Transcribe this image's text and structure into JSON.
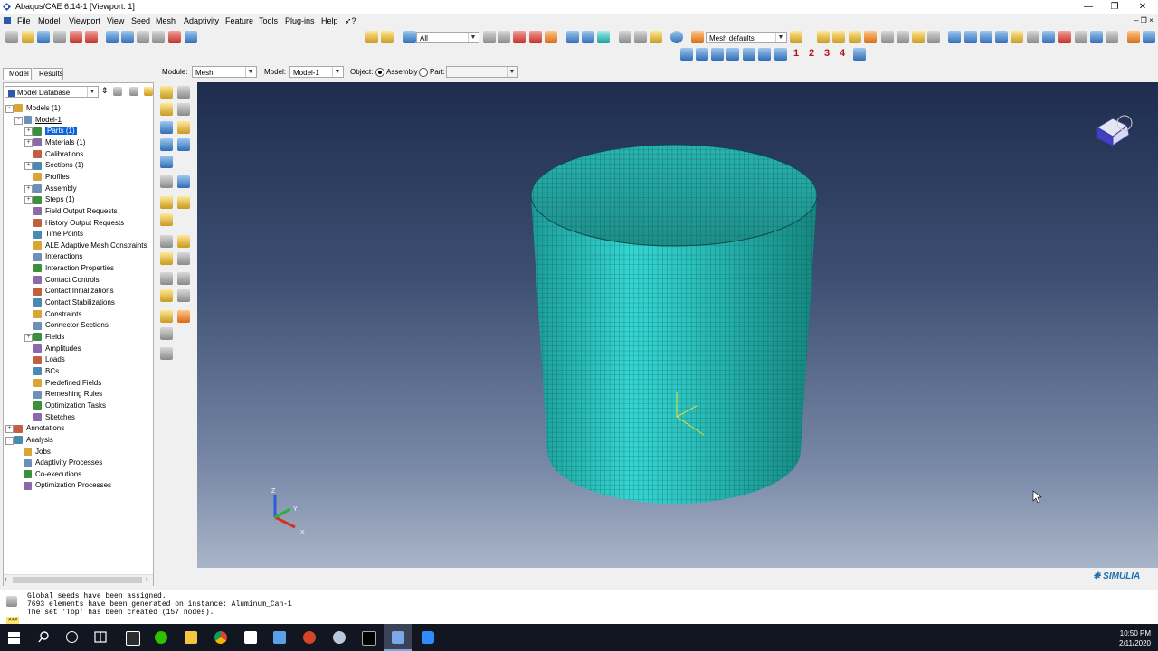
{
  "window": {
    "title": "Abaqus/CAE 6.14-1 [Viewport: 1]"
  },
  "menu": [
    "File",
    "Model",
    "Viewport",
    "View",
    "Seed",
    "Mesh",
    "Adaptivity",
    "Feature",
    "Tools",
    "Plug-ins",
    "Help"
  ],
  "help_glyph": "➶?",
  "toolbar": {
    "selection_filter": "All",
    "mesh_defaults": "Mesh defaults",
    "view_numbers": [
      "1",
      "2",
      "3",
      "4"
    ]
  },
  "tabs": [
    "Model",
    "Results"
  ],
  "context_bar": {
    "module_label": "Module:",
    "module_value": "Mesh",
    "model_label": "Model:",
    "model_value": "Model-1",
    "object_label": "Object:",
    "assembly_label": "Assembly",
    "part_label": "Part:",
    "part_value": ""
  },
  "tree": {
    "database_combo": "Model Database",
    "items": [
      {
        "label": "Models (1)",
        "depth": 0,
        "exp": "-"
      },
      {
        "label": "Model-1",
        "depth": 1,
        "exp": "-",
        "underline": true
      },
      {
        "label": "Parts (1)",
        "depth": 2,
        "exp": "+",
        "selected": true
      },
      {
        "label": "Materials (1)",
        "depth": 2,
        "exp": "+"
      },
      {
        "label": "Calibrations",
        "depth": 2
      },
      {
        "label": "Sections (1)",
        "depth": 2,
        "exp": "+"
      },
      {
        "label": "Profiles",
        "depth": 2
      },
      {
        "label": "Assembly",
        "depth": 2,
        "exp": "+"
      },
      {
        "label": "Steps (1)",
        "depth": 2,
        "exp": "+"
      },
      {
        "label": "Field Output Requests",
        "depth": 2
      },
      {
        "label": "History Output Requests",
        "depth": 2
      },
      {
        "label": "Time Points",
        "depth": 2
      },
      {
        "label": "ALE Adaptive Mesh Constraints",
        "depth": 2
      },
      {
        "label": "Interactions",
        "depth": 2
      },
      {
        "label": "Interaction Properties",
        "depth": 2
      },
      {
        "label": "Contact Controls",
        "depth": 2
      },
      {
        "label": "Contact Initializations",
        "depth": 2
      },
      {
        "label": "Contact Stabilizations",
        "depth": 2
      },
      {
        "label": "Constraints",
        "depth": 2
      },
      {
        "label": "Connector Sections",
        "depth": 2
      },
      {
        "label": "Fields",
        "depth": 2,
        "exp": "+"
      },
      {
        "label": "Amplitudes",
        "depth": 2
      },
      {
        "label": "Loads",
        "depth": 2
      },
      {
        "label": "BCs",
        "depth": 2
      },
      {
        "label": "Predefined Fields",
        "depth": 2
      },
      {
        "label": "Remeshing Rules",
        "depth": 2
      },
      {
        "label": "Optimization Tasks",
        "depth": 2
      },
      {
        "label": "Sketches",
        "depth": 2
      },
      {
        "label": "Annotations",
        "depth": 0,
        "exp": "+"
      },
      {
        "label": "Analysis",
        "depth": 0,
        "exp": "-"
      },
      {
        "label": "Jobs",
        "depth": 1
      },
      {
        "label": "Adaptivity Processes",
        "depth": 1
      },
      {
        "label": "Co-executions",
        "depth": 1
      },
      {
        "label": "Optimization Processes",
        "depth": 1
      }
    ]
  },
  "viewport": {
    "triad": {
      "x": "X",
      "y": "Y",
      "z": "Z"
    },
    "logo": "SIMULIA"
  },
  "messages": [
    "Global seeds have been assigned.",
    "7693 elements have been generated on instance: Aluminum_Can-1",
    "The set 'Top' has been created (157 nodes)."
  ],
  "prompt_glyph": ">>>",
  "taskbar": {
    "time": "10:50 PM",
    "date": "2/11/2020"
  },
  "colors": {
    "mesh": "#2ec7c4",
    "viewport_top": "#1e2d4e",
    "viewport_bottom": "#a9b5c8"
  }
}
